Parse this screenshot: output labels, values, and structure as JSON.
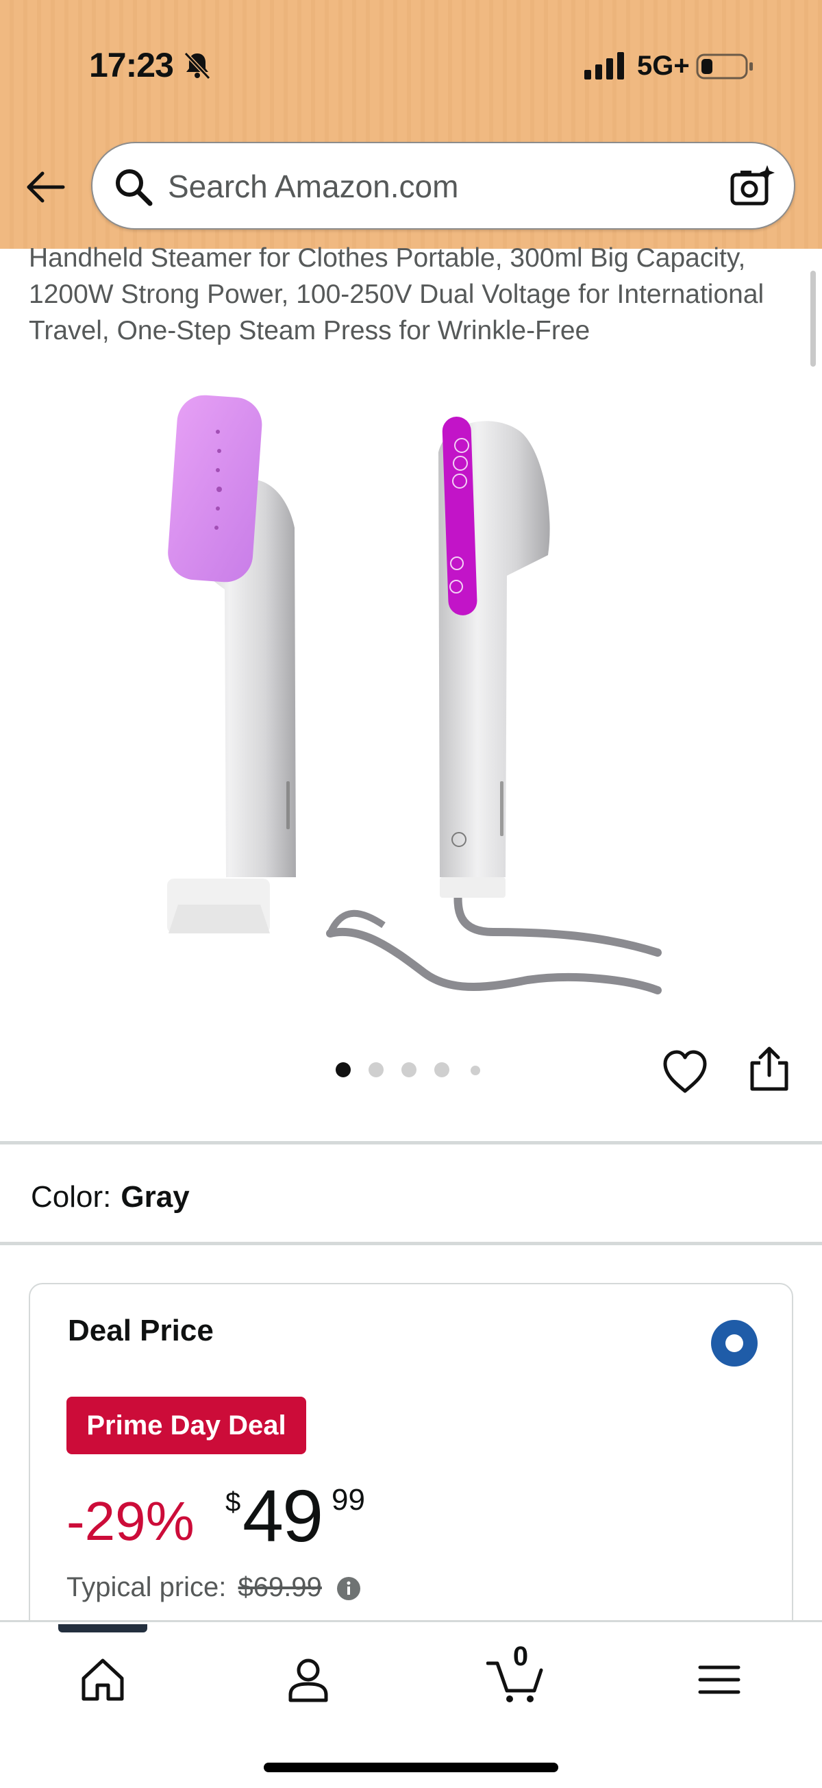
{
  "status_bar": {
    "time": "17:23",
    "network": "5G+",
    "icons": [
      "bell-slash-icon",
      "signal-icon",
      "battery-icon"
    ]
  },
  "header": {
    "back_icon": "arrow-left-icon",
    "search": {
      "placeholder": "Search Amazon.com",
      "value": ""
    },
    "camera_icon": "camera-sparkle-icon"
  },
  "product": {
    "title": "Handheld Steamer for Clothes Portable, 300ml Big Capacity, 1200W Strong Power, 100-250V Dual Voltage for International Travel, One-Step Steam Press for Wrinkle-Free",
    "image_count": 5,
    "current_image": 1,
    "actions": [
      "heart-icon",
      "share-icon"
    ]
  },
  "color": {
    "label": "Color:",
    "value": "Gray"
  },
  "deal": {
    "title": "Deal Price",
    "selected": true,
    "badge": "Prime Day Deal",
    "discount": "-29%",
    "currency": "$",
    "price_whole": "49",
    "price_fraction": "99",
    "typical_label": "Typical price:",
    "typical_price": "$69.99"
  },
  "bottom_nav": {
    "items": [
      "home-icon",
      "account-icon",
      "cart-icon",
      "menu-icon"
    ],
    "cart_count": "0",
    "active": "home-icon"
  },
  "colors": {
    "header_bg": "#f0b981",
    "deal_red": "#cc0c39",
    "radio_blue": "#1f5ca8",
    "accent_purple": "#d14cd8"
  }
}
